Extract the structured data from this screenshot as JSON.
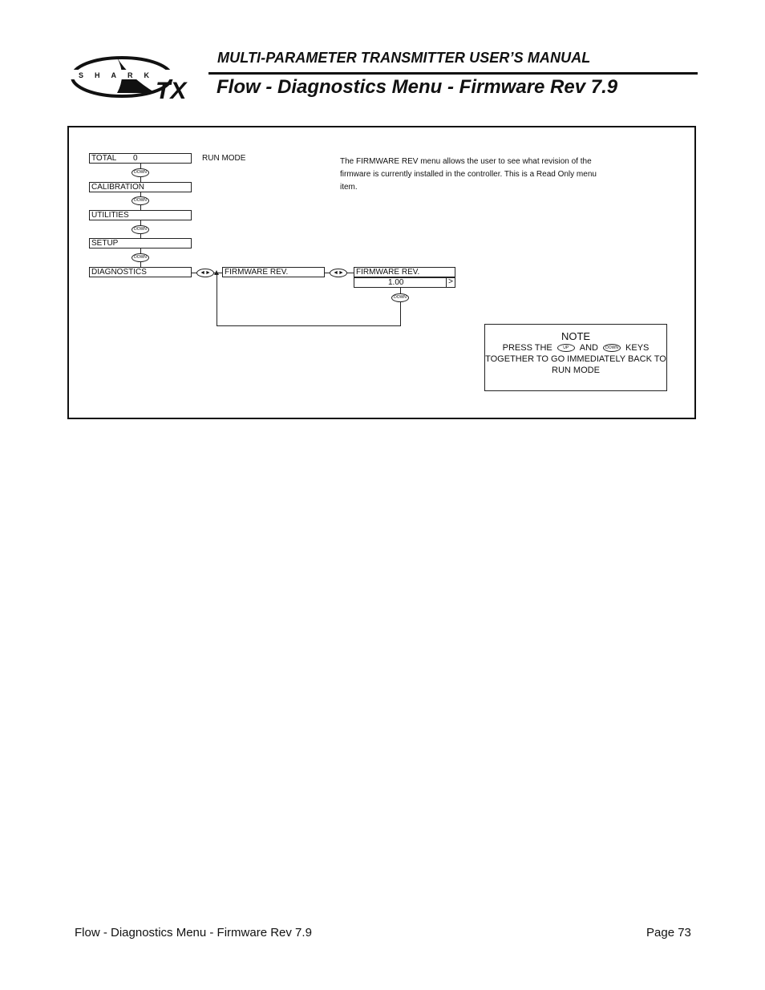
{
  "header": {
    "logo_text": "SHARK",
    "logo_suffix": "TX",
    "subtitle": "MULTI-PARAMETER TRANSMITTER USER’S MANUAL",
    "title": "Flow - Diagnostics Menu - Firmware Rev 7.9"
  },
  "diagram": {
    "menu_items": [
      {
        "label": "TOTAL",
        "value": "0"
      },
      {
        "label": "CALIBRATION"
      },
      {
        "label": "UTILITIES"
      },
      {
        "label": "SETUP"
      },
      {
        "label": "DIAGNOSTICS"
      }
    ],
    "run_mode_label": "RUN MODE",
    "down_key": "DOWN",
    "up_key": "UP",
    "lr_key": "◄►",
    "firmware_menu_label": "FIRMWARE REV.",
    "firmware_display_label": "FIRMWARE REV.",
    "firmware_value": "1.00",
    "scroll_indicator": ">",
    "description": "The FIRMWARE REV menu allows the user to see what revision of the firmware is currently installed in the controller.  This is a Read Only menu item.",
    "note": {
      "title": "NOTE",
      "line1_pre": "PRESS THE",
      "line1_mid": "AND",
      "line1_post": "KEYS",
      "line2": "TOGETHER TO GO IMMEDIATELY BACK TO",
      "line3": "RUN MODE"
    }
  },
  "footer": {
    "section": "Flow - Diagnostics Menu - Firmware Rev 7.9",
    "page": "Page 73"
  }
}
